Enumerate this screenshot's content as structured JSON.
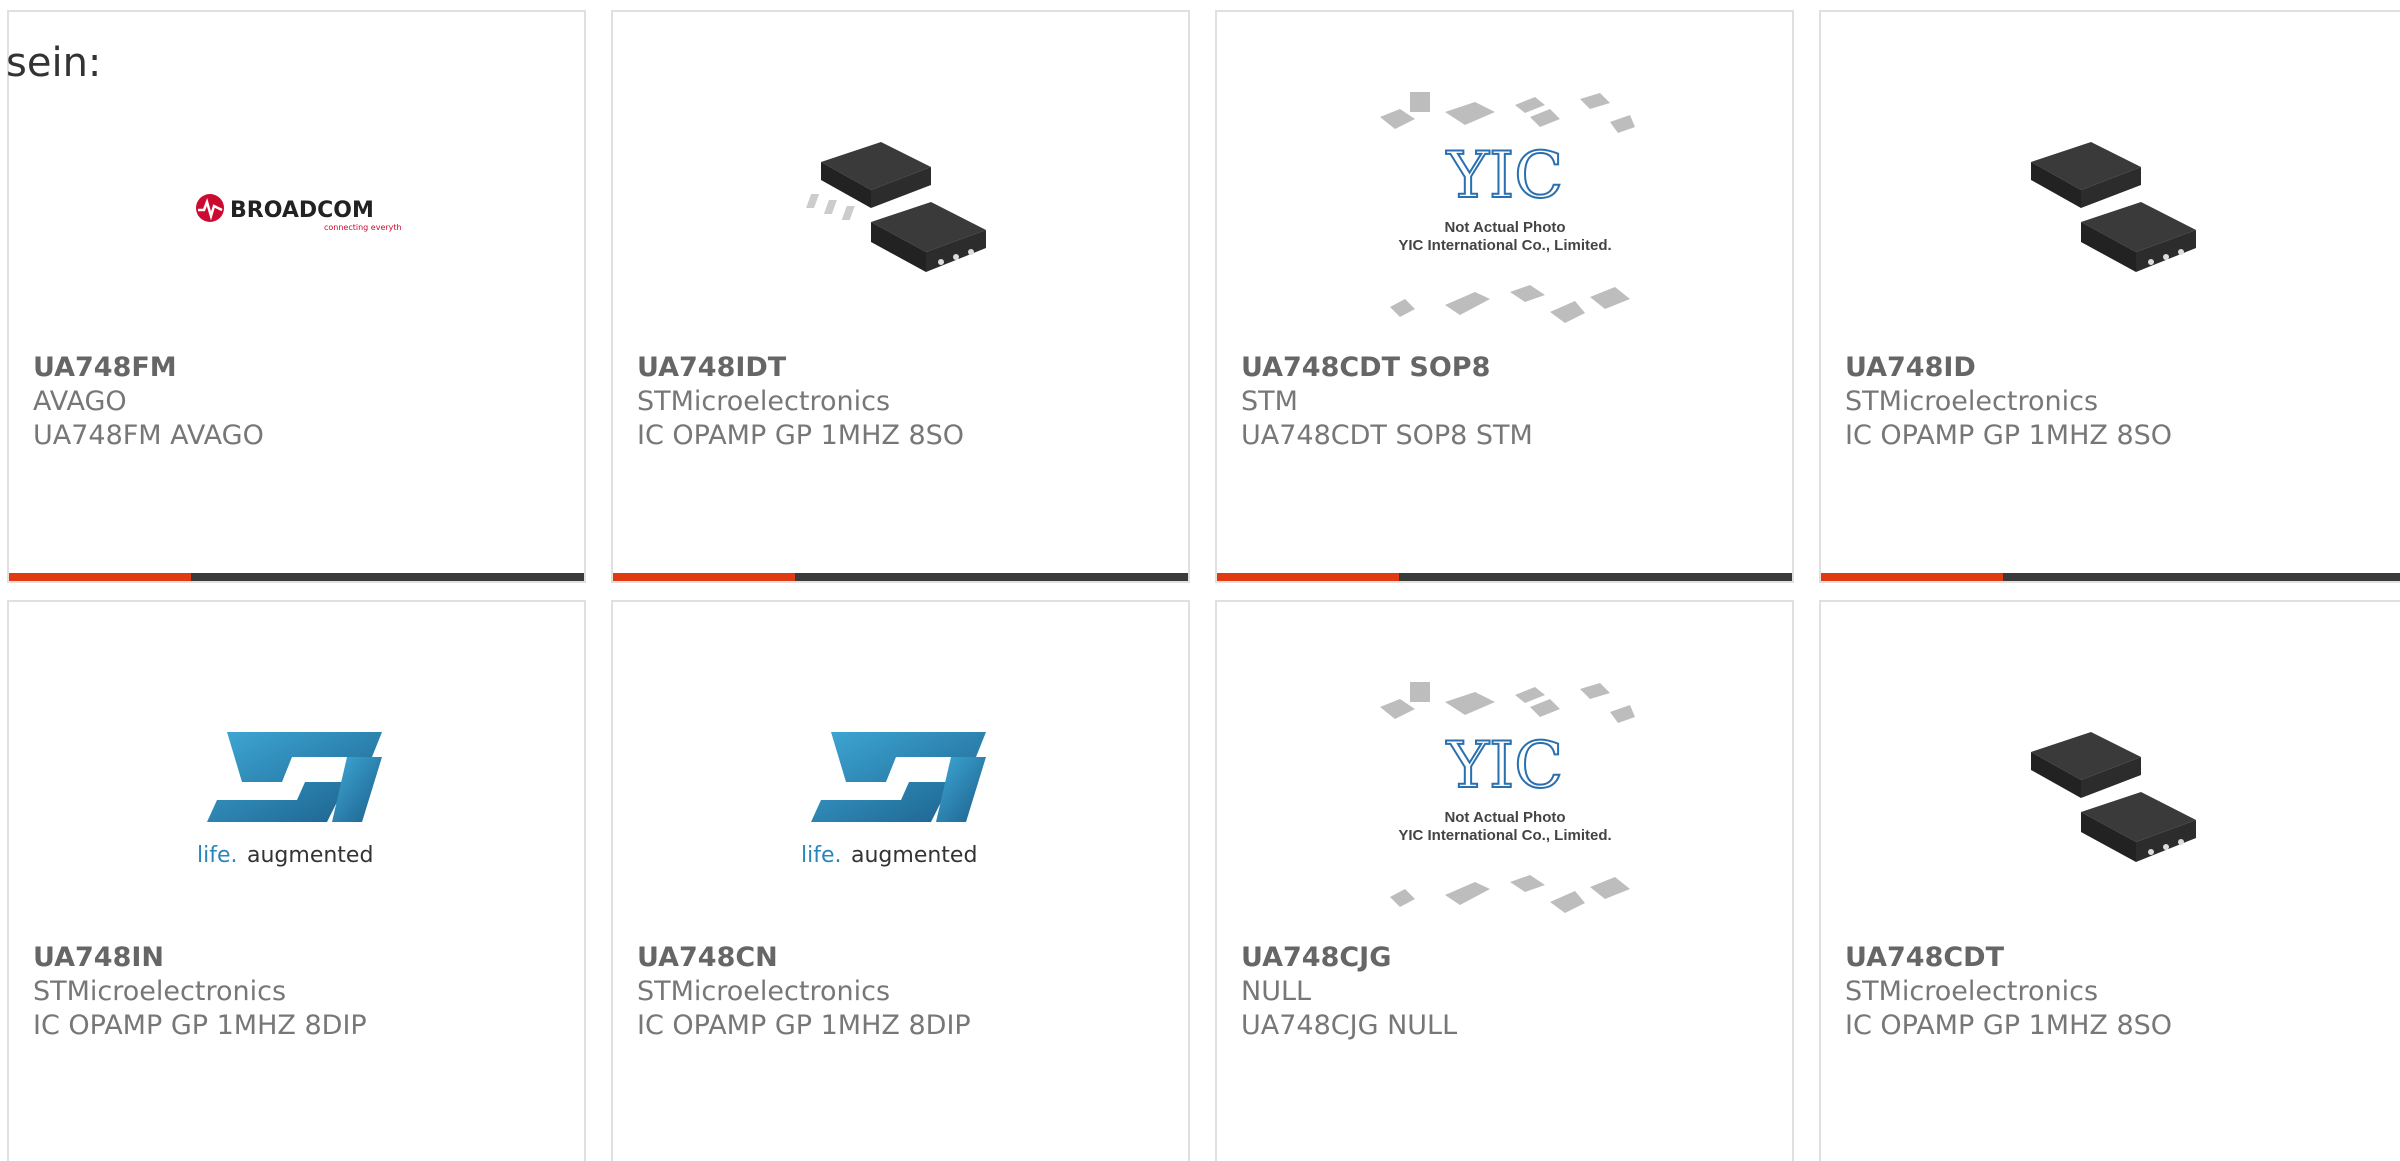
{
  "header": {
    "label": "sein:"
  },
  "colors": {
    "accent": "#e03a12",
    "bar": "#3a3a3a",
    "border": "#e0e0e0",
    "broadcom_red": "#cc092f",
    "st_blue": "#2a86b8"
  },
  "products": [
    {
      "part": "UA748FM",
      "maker": "AVAGO",
      "desc": "UA748FM AVAGO",
      "image": "broadcom-logo",
      "logo_text": "BROADCOM",
      "logo_sub": "connecting everything"
    },
    {
      "part": "UA748IDT",
      "maker": "STMicroelectronics",
      "desc": "IC OPAMP GP 1MHZ 8SO",
      "image": "soic8-chip"
    },
    {
      "part": "UA748CDT SOP8",
      "maker": "STM",
      "desc": "UA748CDT SOP8 STM",
      "image": "yic-placeholder",
      "placeholder_line1": "Not Actual Photo",
      "placeholder_line2": "YIC International Co., Limited."
    },
    {
      "part": "UA748ID",
      "maker": "STMicroelectronics",
      "desc": "IC OPAMP GP 1MHZ 8SO",
      "image": "soic8-chip"
    },
    {
      "part": "UA748IN",
      "maker": "STMicroelectronics",
      "desc": "IC OPAMP GP 1MHZ 8DIP",
      "image": "st-logo",
      "logo_sub_a": "life.",
      "logo_sub_b": "augmented"
    },
    {
      "part": "UA748CN",
      "maker": "STMicroelectronics",
      "desc": "IC OPAMP GP 1MHZ 8DIP",
      "image": "st-logo",
      "logo_sub_a": "life.",
      "logo_sub_b": "augmented"
    },
    {
      "part": "UA748CJG",
      "maker": "NULL",
      "desc": "UA748CJG NULL",
      "image": "yic-placeholder",
      "placeholder_line1": "Not Actual Photo",
      "placeholder_line2": "YIC International Co., Limited."
    },
    {
      "part": "UA748CDT",
      "maker": "STMicroelectronics",
      "desc": "IC OPAMP GP 1MHZ 8SO",
      "image": "soic8-chip"
    }
  ]
}
